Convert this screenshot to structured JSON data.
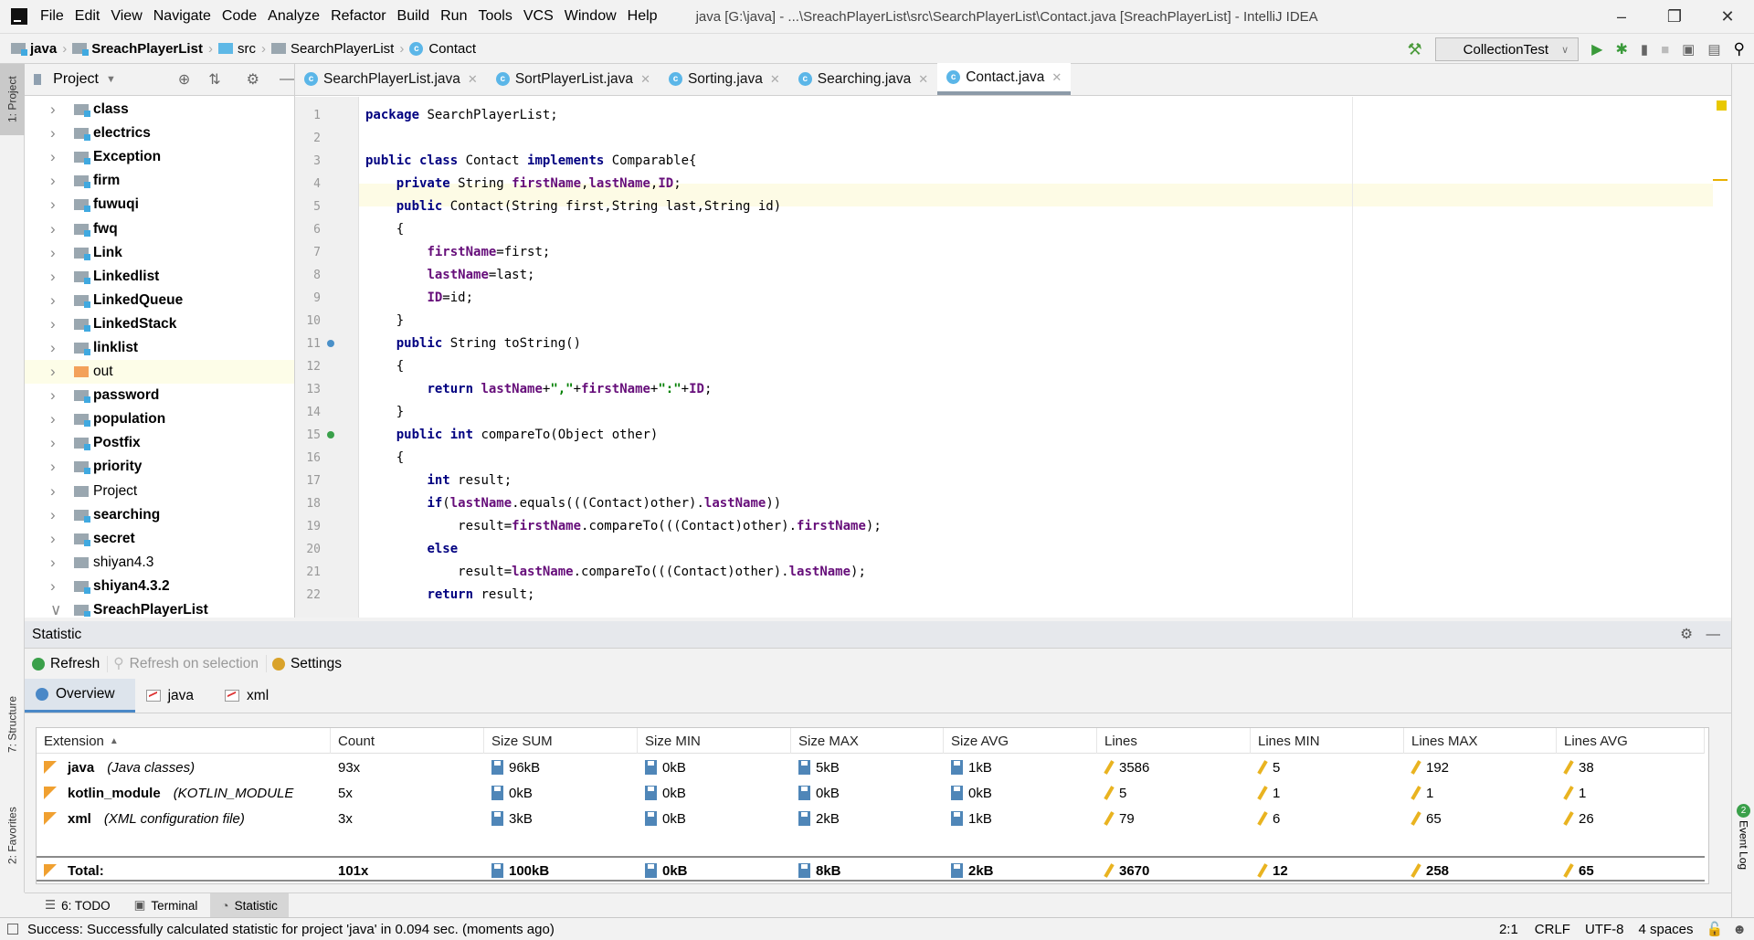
{
  "menubar": {
    "items": [
      "File",
      "Edit",
      "View",
      "Navigate",
      "Code",
      "Analyze",
      "Refactor",
      "Build",
      "Run",
      "Tools",
      "VCS",
      "Window",
      "Help"
    ],
    "title": "java [G:\\java] - ...\\SreachPlayerList\\src\\SearchPlayerList\\Contact.java [SreachPlayerList] - IntelliJ IDEA"
  },
  "breadcrumb": [
    {
      "label": "java",
      "icon": "module"
    },
    {
      "label": "SreachPlayerList",
      "icon": "module"
    },
    {
      "label": "src",
      "icon": "src-folder"
    },
    {
      "label": "SearchPlayerList",
      "icon": "package"
    },
    {
      "label": "Contact",
      "icon": "class"
    }
  ],
  "runbar": {
    "config": "CollectionTest"
  },
  "left_stripe": {
    "project": "1: Project",
    "structure": "7: Structure",
    "favorites": "2: Favorites"
  },
  "right_stripe": {
    "event_log": "Event Log",
    "event_badge": "2"
  },
  "project_panel": {
    "title": "Project",
    "items": [
      {
        "label": "class",
        "type": "package"
      },
      {
        "label": "electrics",
        "type": "package"
      },
      {
        "label": "Exception",
        "type": "package"
      },
      {
        "label": "firm",
        "type": "package"
      },
      {
        "label": "fuwuqi",
        "type": "package"
      },
      {
        "label": "fwq",
        "type": "package"
      },
      {
        "label": "Link",
        "type": "package"
      },
      {
        "label": "Linkedlist",
        "type": "package"
      },
      {
        "label": "LinkedQueue",
        "type": "package"
      },
      {
        "label": "LinkedStack",
        "type": "package"
      },
      {
        "label": "linklist",
        "type": "package"
      },
      {
        "label": "out",
        "type": "output"
      },
      {
        "label": "password",
        "type": "package"
      },
      {
        "label": "population",
        "type": "package"
      },
      {
        "label": "Postfix",
        "type": "package"
      },
      {
        "label": "priority",
        "type": "package"
      },
      {
        "label": "Project",
        "type": "folder"
      },
      {
        "label": "searching",
        "type": "package"
      },
      {
        "label": "secret",
        "type": "package"
      },
      {
        "label": "shiyan4.3",
        "type": "folder"
      },
      {
        "label": "shiyan4.3.2",
        "type": "package"
      },
      {
        "label": "SreachPlayerList",
        "type": "package",
        "expanded": true
      }
    ]
  },
  "editor": {
    "tabs": [
      {
        "label": "SearchPlayerList.java"
      },
      {
        "label": "SortPlayerList.java"
      },
      {
        "label": "Sorting.java"
      },
      {
        "label": "Searching.java"
      },
      {
        "label": "Contact.java",
        "active": true
      }
    ],
    "lines": [
      [
        [
          "package",
          "kw"
        ],
        [
          " SearchPlayerList;",
          ""
        ]
      ],
      [],
      [
        [
          "public class",
          "kw"
        ],
        [
          " Contact ",
          ""
        ],
        [
          "implements",
          "kw"
        ],
        [
          " Comparable{",
          ""
        ]
      ],
      [
        [
          "    ",
          ""
        ],
        [
          "private",
          "kw"
        ],
        [
          " String ",
          ""
        ],
        [
          "firstName",
          "fld"
        ],
        [
          ",",
          ""
        ],
        [
          "lastName",
          "fld"
        ],
        [
          ",",
          ""
        ],
        [
          "ID",
          "fld"
        ],
        [
          ";",
          ""
        ]
      ],
      [
        [
          "    ",
          ""
        ],
        [
          "public",
          "kw"
        ],
        [
          " Contact(String first,String last,String id)",
          ""
        ]
      ],
      [
        [
          "    {",
          ""
        ]
      ],
      [
        [
          "        ",
          ""
        ],
        [
          "firstName",
          "fld"
        ],
        [
          "=first;",
          ""
        ]
      ],
      [
        [
          "        ",
          ""
        ],
        [
          "lastName",
          "fld"
        ],
        [
          "=last;",
          ""
        ]
      ],
      [
        [
          "        ",
          ""
        ],
        [
          "ID",
          "fld"
        ],
        [
          "=id;",
          ""
        ]
      ],
      [
        [
          "    }",
          ""
        ]
      ],
      [
        [
          "    ",
          ""
        ],
        [
          "public",
          "kw"
        ],
        [
          " String toString()",
          ""
        ]
      ],
      [
        [
          "    {",
          ""
        ]
      ],
      [
        [
          "        ",
          ""
        ],
        [
          "return",
          "kw"
        ],
        [
          " ",
          ""
        ],
        [
          "lastName",
          "fld"
        ],
        [
          "+",
          ""
        ],
        [
          "\",\"",
          "str"
        ],
        [
          "+",
          ""
        ],
        [
          "firstName",
          "fld"
        ],
        [
          "+",
          ""
        ],
        [
          "\":\"",
          "str"
        ],
        [
          "+",
          ""
        ],
        [
          "ID",
          "fld"
        ],
        [
          ";",
          ""
        ]
      ],
      [
        [
          "    }",
          ""
        ]
      ],
      [
        [
          "    ",
          ""
        ],
        [
          "public int",
          "kw"
        ],
        [
          " compareTo(Object other)",
          ""
        ]
      ],
      [
        [
          "    {",
          ""
        ]
      ],
      [
        [
          "        ",
          ""
        ],
        [
          "int",
          "kw"
        ],
        [
          " result;",
          ""
        ]
      ],
      [
        [
          "        ",
          ""
        ],
        [
          "if",
          "kw"
        ],
        [
          "(",
          ""
        ],
        [
          "lastName",
          "fld"
        ],
        [
          ".equals(((Contact)other).",
          ""
        ],
        [
          "lastName",
          "fld"
        ],
        [
          "))",
          ""
        ]
      ],
      [
        [
          "            result=",
          ""
        ],
        [
          "firstName",
          "fld"
        ],
        [
          ".compareTo(((Contact)other).",
          ""
        ],
        [
          "firstName",
          "fld"
        ],
        [
          ");",
          ""
        ]
      ],
      [
        [
          "        ",
          ""
        ],
        [
          "else",
          "kw"
        ]
      ],
      [
        [
          "            result=",
          ""
        ],
        [
          "lastName",
          "fld"
        ],
        [
          ".compareTo(((Contact)other).",
          ""
        ],
        [
          "lastName",
          "fld"
        ],
        [
          ");",
          ""
        ]
      ],
      [
        [
          "        ",
          ""
        ],
        [
          "return",
          "kw"
        ],
        [
          " result;",
          ""
        ]
      ]
    ]
  },
  "statistic": {
    "title": "Statistic",
    "toolbar": {
      "refresh": "Refresh",
      "refresh_selection": "Refresh on selection",
      "settings": "Settings"
    },
    "tabs": [
      {
        "label": "Overview",
        "active": true
      },
      {
        "label": "java"
      },
      {
        "label": "xml"
      }
    ],
    "columns": [
      "Extension",
      "Count",
      "Size SUM",
      "Size MIN",
      "Size MAX",
      "Size AVG",
      "Lines",
      "Lines MIN",
      "Lines MAX",
      "Lines AVG"
    ],
    "rows": [
      {
        "ext": "java",
        "desc": "(Java classes)",
        "values": [
          "93x",
          "96kB",
          "0kB",
          "5kB",
          "1kB",
          "3586",
          "5",
          "192",
          "38"
        ]
      },
      {
        "ext": "kotlin_module",
        "desc": "(KOTLIN_MODULE",
        "values": [
          "5x",
          "0kB",
          "0kB",
          "0kB",
          "0kB",
          "5",
          "1",
          "1",
          "1"
        ]
      },
      {
        "ext": "xml",
        "desc": "(XML configuration file)",
        "values": [
          "3x",
          "3kB",
          "0kB",
          "2kB",
          "1kB",
          "79",
          "6",
          "65",
          "26"
        ]
      }
    ],
    "total": {
      "label": "Total:",
      "values": [
        "101x",
        "100kB",
        "0kB",
        "8kB",
        "2kB",
        "3670",
        "12",
        "258",
        "65"
      ]
    }
  },
  "bottom_tools": [
    {
      "label": "6: TODO"
    },
    {
      "label": "Terminal"
    },
    {
      "label": "Statistic",
      "active": true
    }
  ],
  "statusbar": {
    "message": "Success: Successfully calculated statistic for project 'java' in 0.094 sec. (moments ago)",
    "position": "2:1",
    "line_sep": "CRLF",
    "encoding": "UTF-8",
    "indent": "4 spaces"
  }
}
